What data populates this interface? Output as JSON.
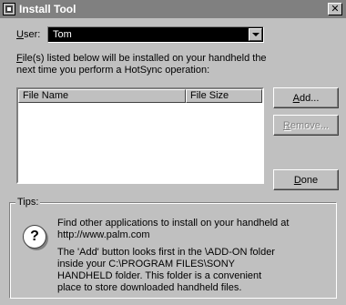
{
  "window": {
    "title": "Install Tool",
    "close_glyph": "✕"
  },
  "user": {
    "label_first": "U",
    "label_rest": "ser:",
    "selected": "Tom"
  },
  "info": {
    "line_first": "F",
    "line_rest": "ile(s) listed below will be installed on your handheld the next time you perform a HotSync operation:"
  },
  "file_list": {
    "columns": [
      "File Name",
      "File Size"
    ],
    "rows": []
  },
  "buttons": {
    "add_first": "A",
    "add_rest": "dd...",
    "remove_first": "R",
    "remove_rest": "emove...",
    "done_first": "D",
    "done_rest": "one"
  },
  "tips": {
    "legend": "Tips:",
    "icon_glyph": "?",
    "tip1": "Find other applications to install on your handheld at http://www.palm.com",
    "tip2": "The 'Add' button looks first in the \\ADD-ON folder\ninside your C:\\PROGRAM FILES\\SONY\nHANDHELD folder. This folder is a convenient\nplace to store downloaded handheld files."
  },
  "icons": [
    "app-icon",
    "close-icon",
    "dropdown-arrow-icon",
    "question-icon"
  ]
}
